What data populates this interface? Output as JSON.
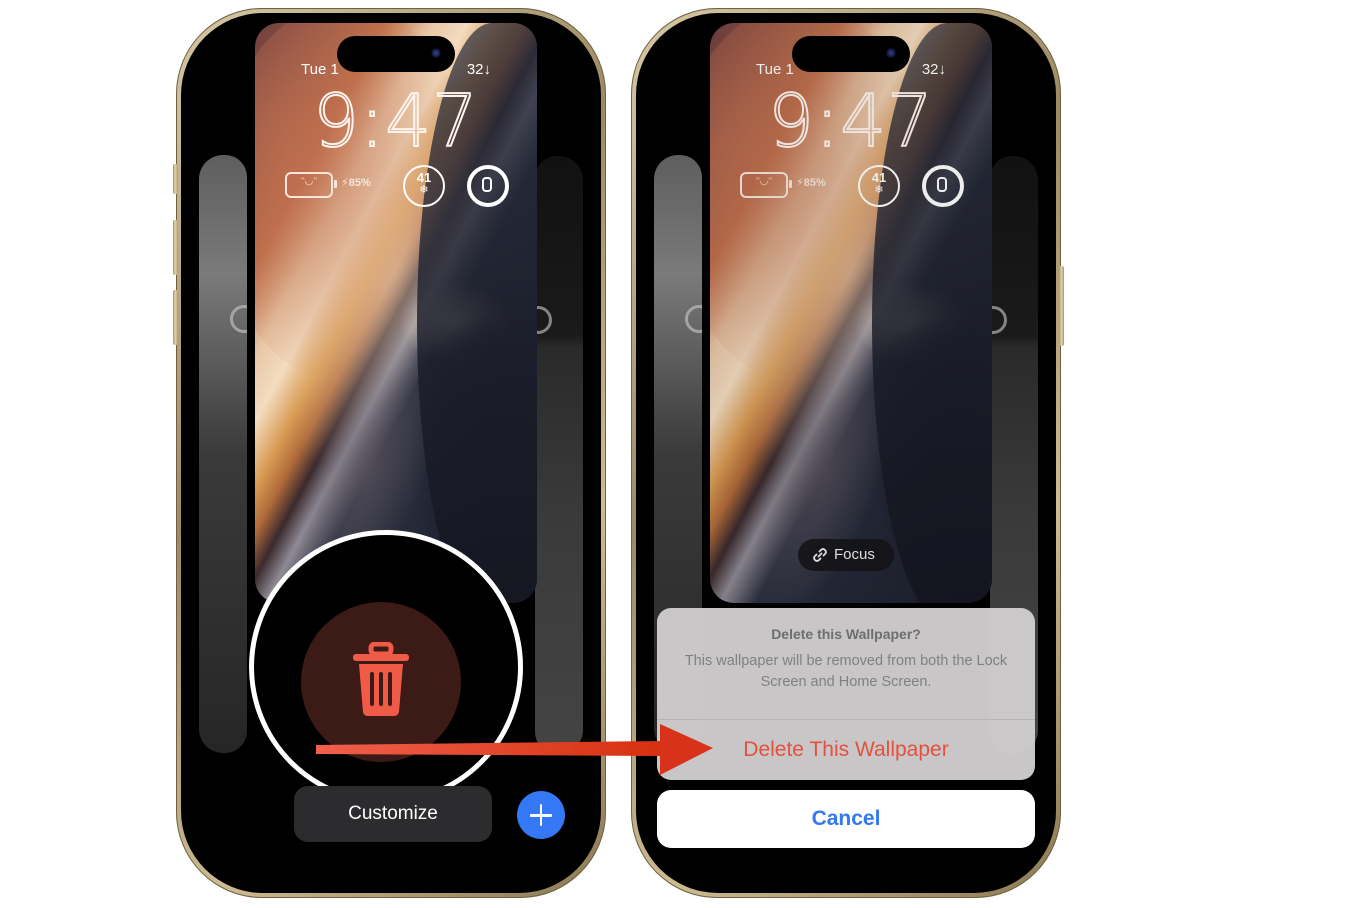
{
  "left_phone": {
    "lock_screen": {
      "date": "Tue 1",
      "weather_status": "32↓",
      "time": "9:47",
      "battery_faces": "ᵔ◡ᵔ",
      "battery_percent": "85%",
      "temperature_widget": "41",
      "temperature_icon": "❄",
      "watch_widget_icon": "watch-icon"
    },
    "delete_button_icon": "trash-icon",
    "customize_label": "Customize",
    "add_icon": "plus-icon"
  },
  "right_phone": {
    "lock_screen": {
      "date": "Tue 1",
      "weather_status": "32↓",
      "time": "9:47",
      "battery_faces": "ᵔ◡ᵔ",
      "battery_percent": "85%",
      "temperature_widget": "41",
      "temperature_icon": "❄",
      "watch_widget_icon": "watch-icon"
    },
    "focus_label": "Focus",
    "action_sheet": {
      "title": "Delete this Wallpaper?",
      "message": "This wallpaper will be removed from both the Lock Screen and Home Screen.",
      "destructive_label": "Delete This Wallpaper",
      "cancel_label": "Cancel"
    }
  },
  "colors": {
    "destructive": "#e5503f",
    "accent_blue": "#3478f6",
    "arrow": "#e0361f",
    "phone_frame": "#c8b78e"
  }
}
